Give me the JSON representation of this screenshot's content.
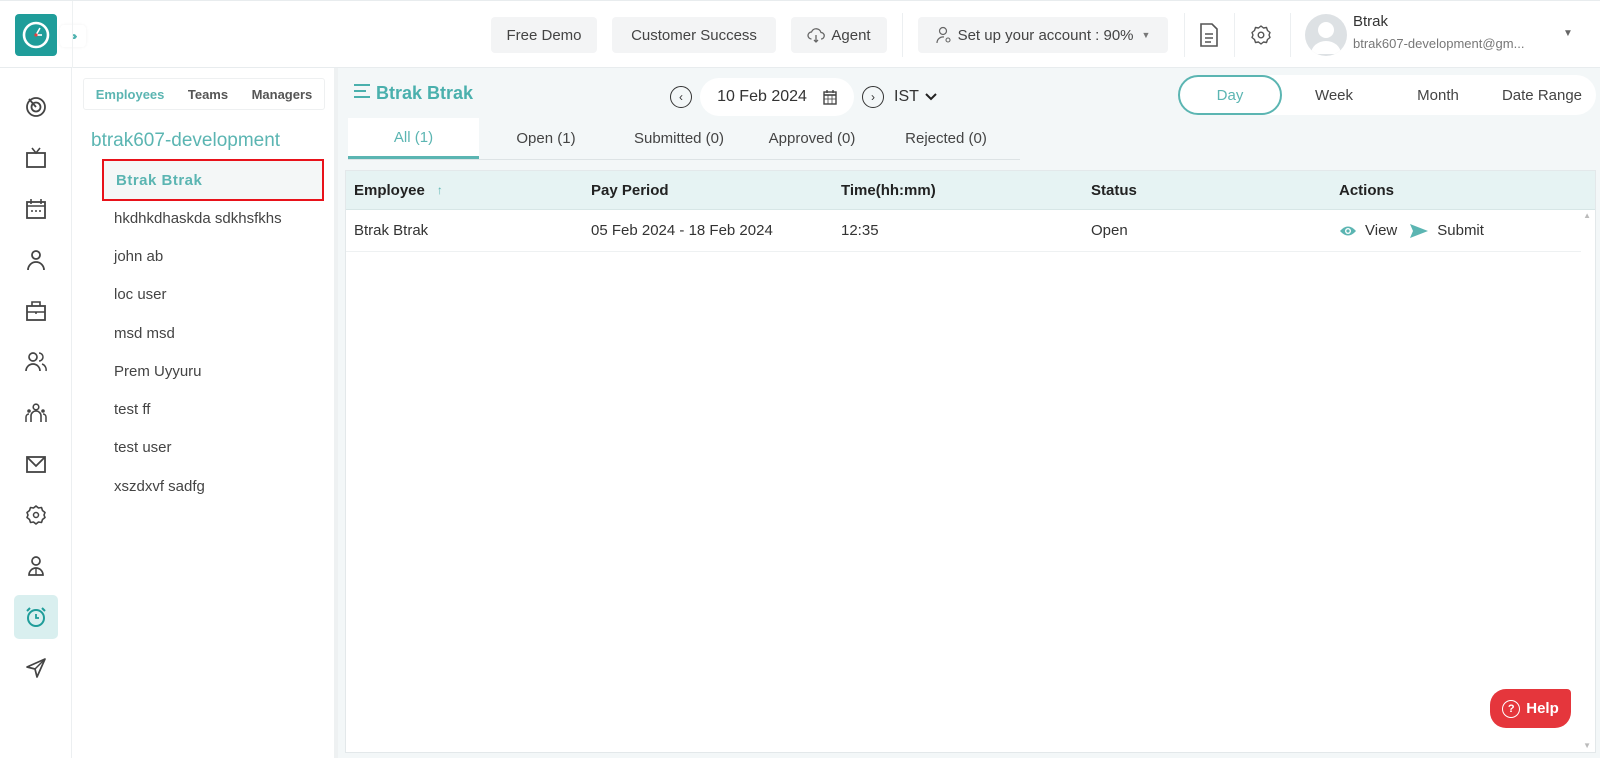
{
  "header": {
    "logo_icon": "clock-logo-icon",
    "expand_icon": "triple-chevron-right-icon",
    "free_demo": "Free Demo",
    "customer_success": "Customer Success",
    "agent": "Agent",
    "agent_icon": "cloud-download-icon",
    "setup_account": "Set up your account : 90%",
    "setup_progress_percent": 90,
    "document_icon": "document-icon",
    "settings_icon": "gear-icon",
    "user": {
      "name": "Btrak",
      "email": "btrak607-development@gm..."
    }
  },
  "rail": {
    "items": [
      {
        "icon": "dashboard-target-icon"
      },
      {
        "icon": "tv-icon"
      },
      {
        "icon": "calendar-icon"
      },
      {
        "icon": "user-icon"
      },
      {
        "icon": "briefcase-icon"
      },
      {
        "icon": "users-icon"
      },
      {
        "icon": "team-icon"
      },
      {
        "icon": "mail-icon"
      },
      {
        "icon": "settings-icon"
      },
      {
        "icon": "profile-icon"
      },
      {
        "icon": "alarm-clock-icon",
        "active": true
      },
      {
        "icon": "send-icon"
      }
    ]
  },
  "employee_panel": {
    "tabs": [
      "Employees",
      "Teams",
      "Managers"
    ],
    "active_tab": "Employees",
    "org_name": "btrak607-development",
    "employees": [
      "Btrak Btrak",
      "hkdhkdhaskda sdkhsfkhs",
      "john ab",
      "loc user",
      "msd msd",
      "Prem Uyyuru",
      "test ff",
      "test user",
      "xszdxvf sadfg"
    ],
    "selected_employee": "Btrak Btrak"
  },
  "main": {
    "title": "Btrak Btrak",
    "date": "10 Feb 2024",
    "timezone": "IST",
    "range_options": [
      "Day",
      "Week",
      "Month",
      "Date Range"
    ],
    "active_range": "Day",
    "status_tabs": [
      "All (1)",
      "Open (1)",
      "Submitted (0)",
      "Approved (0)",
      "Rejected (0)"
    ],
    "active_status_tab": "All (1)",
    "table": {
      "columns": [
        "Employee",
        "Pay Period",
        "Time(hh:mm)",
        "Status",
        "Actions"
      ],
      "rows": [
        {
          "employee": "Btrak Btrak",
          "pay_period": "05 Feb 2024 - 18 Feb 2024",
          "time": "12:35",
          "status": "Open",
          "actions": [
            "View",
            "Submit"
          ]
        }
      ]
    }
  },
  "help": {
    "label": "Help"
  },
  "colors": {
    "accent": "#5bb5b2",
    "logo": "#1f9d9a",
    "help": "#e5363c",
    "highlight_border": "#e8121a"
  }
}
